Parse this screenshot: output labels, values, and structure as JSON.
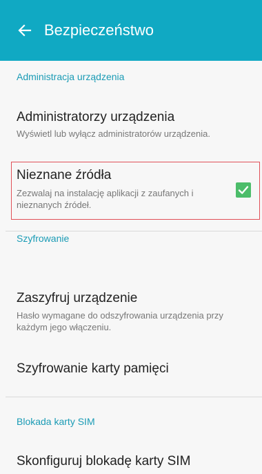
{
  "app_bar": {
    "title": "Bezpieczeństwo",
    "back_icon": "arrow-left-icon",
    "color": "#10a9c3"
  },
  "sections": {
    "device_admin": {
      "header": "Administracja urządzenia"
    },
    "encryption": {
      "header": "Szyfrowanie"
    },
    "sim_lock": {
      "header": "Blokada karty SIM"
    }
  },
  "items": {
    "device_administrators": {
      "title": "Administratorzy urządzenia",
      "subtitle": "Wyświetl lub wyłącz administratorów urządzenia."
    },
    "unknown_sources": {
      "title": "Nieznane źródła",
      "subtitle": "Zezwalaj na instalację aplikacji z zaufanych i nieznanych źródeł.",
      "checked": true,
      "check_icon": "checkmark-icon",
      "check_color": "#4cbd6a"
    },
    "encrypt_device": {
      "title": "Zaszyfruj urządzenie",
      "subtitle": "Hasło wymagane do odszyfrowania urządzenia przy każdym jego włączeniu."
    },
    "encrypt_sd": {
      "title": "Szyfrowanie karty pamięci"
    },
    "sim_lock_setup": {
      "title": "Skonfiguruj blokadę karty SIM"
    }
  },
  "colors": {
    "accent": "#1a9bb5",
    "highlight_border": "#e04f57"
  }
}
